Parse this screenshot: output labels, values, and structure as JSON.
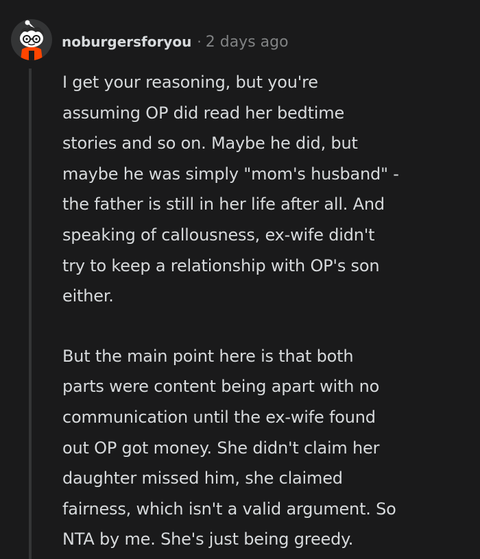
{
  "comment": {
    "author": "noburgersforyou",
    "separator": "·",
    "timestamp": "2 days ago",
    "avatar_icon": "snoo-avatar-glasses-icon",
    "paragraphs": [
      [
        "I get your reasoning, but you're",
        "assuming OP did read her bedtime",
        "stories and so on. Maybe he did, but",
        "maybe he was simply \"mom's husband\" -",
        "the father is still in her life after all. And",
        "speaking of callousness, ex-wife didn't",
        "try to keep a relationship with OP's son",
        "either."
      ],
      [
        "But the main point here is that both",
        "parts were content being apart with no",
        "communication until the ex-wife found",
        "out OP got money. She didn't claim her",
        "daughter missed him, she claimed",
        "fairness, which isn't a valid argument. So",
        "NTA by me. She's just being greedy."
      ]
    ]
  },
  "colors": {
    "background": "#1a1a1b",
    "text": "#d7dadc",
    "meta": "#818384",
    "thread_line": "#343536"
  }
}
